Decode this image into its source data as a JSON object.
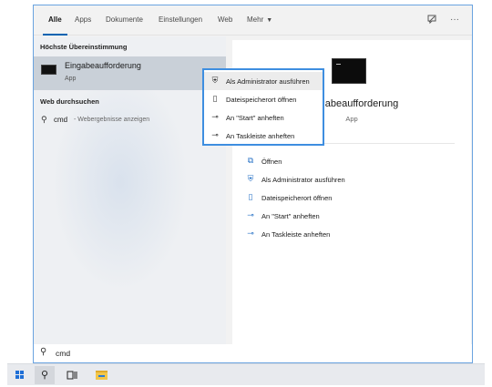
{
  "tabs": {
    "items": [
      "Alle",
      "Apps",
      "Dokumente",
      "Einstellungen",
      "Web",
      "Mehr"
    ],
    "active_index": 0,
    "feedback_icon": "feedback-icon",
    "more_options_icon": "more-options-icon"
  },
  "left": {
    "best_match_heading": "Höchste Übereinstimmung",
    "best_match": {
      "title": "Eingabeaufforderung",
      "subtitle": "App",
      "icon": "command-prompt-icon"
    },
    "web_heading": "Web durchsuchen",
    "web_result": {
      "term": "cmd",
      "hint": "- Webergebnisse anzeigen",
      "icon": "search-icon"
    }
  },
  "right": {
    "app_title": "Eingabeaufforderung",
    "app_subtitle": "App",
    "app_icon": "command-prompt-icon",
    "actions": [
      {
        "label": "Öffnen",
        "icon": "open-icon"
      },
      {
        "label": "Als Administrator ausführen",
        "icon": "run-as-admin-icon"
      },
      {
        "label": "Dateispeicherort öffnen",
        "icon": "file-location-icon"
      },
      {
        "label": "An \"Start\" anheften",
        "icon": "pin-icon"
      },
      {
        "label": "An Taskleiste anheften",
        "icon": "pin-icon"
      }
    ]
  },
  "context_menu": {
    "items": [
      {
        "label": "Als Administrator ausführen",
        "icon": "run-as-admin-icon",
        "highlighted": true
      },
      {
        "label": "Dateispeicherort öffnen",
        "icon": "file-location-icon",
        "highlighted": false
      },
      {
        "label": "An \"Start\" anheften",
        "icon": "pin-icon",
        "highlighted": false
      },
      {
        "label": "An Taskleiste anheften",
        "icon": "pin-icon",
        "highlighted": false
      }
    ]
  },
  "search": {
    "query": "cmd",
    "icon": "search-icon"
  },
  "taskbar": {
    "items": [
      "windows-start-icon",
      "search-icon",
      "task-view-icon",
      "file-explorer-icon"
    ],
    "active_index": 1
  },
  "colors": {
    "accent": "#0063b1",
    "border": "#6aa3e0",
    "highlight": "#c9d0d8"
  }
}
